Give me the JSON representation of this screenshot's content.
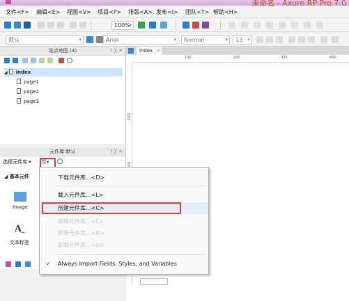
{
  "window": {
    "title": "未命名 - Axure RP Pro 7.0"
  },
  "menubar": {
    "items": [
      "文件<F>",
      "编辑<E>",
      "视图<V>",
      "项目<P>",
      "排版<A>",
      "发布<I>",
      "团队<T>",
      "帮助<H>"
    ]
  },
  "toolbar": {
    "zoom": "100%",
    "style_select": "默认",
    "font_select": "Arial",
    "weight_select": "Normal",
    "size_select": "13"
  },
  "sitemap": {
    "title": "站点地图 (4)",
    "controls": "? ╳ ✕",
    "root": "index",
    "pages": [
      "page1",
      "page2",
      "page3"
    ]
  },
  "library": {
    "title": "元件库:默认",
    "controls": "? ╳ ✕",
    "select_label": "选择元件库",
    "section": "◢ 基本元件",
    "widgets": [
      "Image",
      "文本标签"
    ]
  },
  "canvas": {
    "tab": "index",
    "ruler_h": [
      "100",
      "200",
      "300",
      "400"
    ],
    "ruler_v": [
      "100",
      "200"
    ]
  },
  "dropdown": {
    "items": [
      {
        "label": "下载元件库...<D>",
        "enabled": true
      },
      {
        "label": "载入元件库...<L>",
        "enabled": true
      },
      {
        "label": "创建元件库...<C>",
        "enabled": true
      },
      {
        "label": "编辑元件库...<E>",
        "enabled": false
      },
      {
        "label": "刷新元件库...<R>",
        "enabled": false
      },
      {
        "label": "卸载元件库...<U>",
        "enabled": false
      }
    ],
    "checked_option": "Always Import Fields, Styles, and Variables"
  },
  "colors": {
    "accent": "#e03a3a",
    "titlebar": "#d4a7dd",
    "icon_blue": "#2c7bd6"
  }
}
